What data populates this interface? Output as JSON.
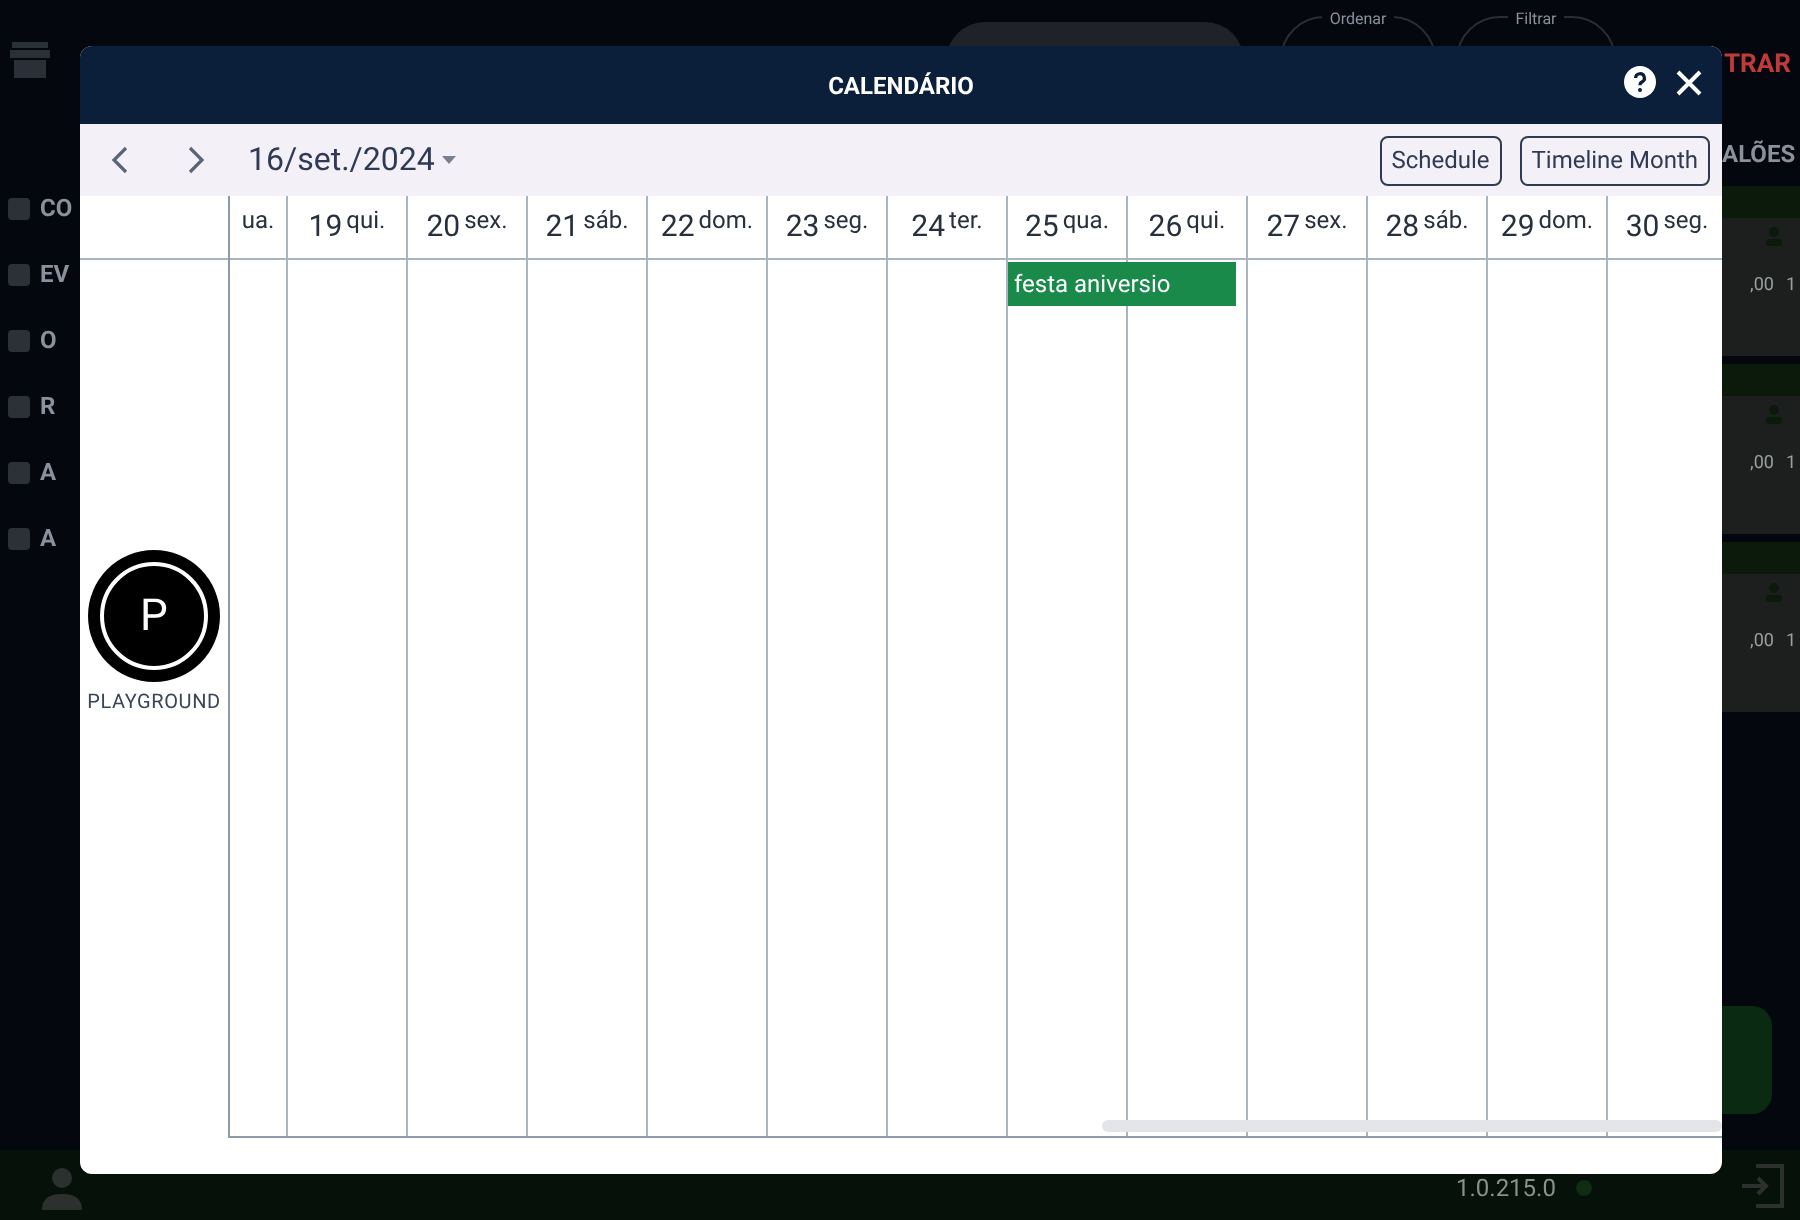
{
  "background_app": {
    "sidebar": [
      {
        "label": "CO"
      },
      {
        "label": "EV"
      },
      {
        "label": "O"
      },
      {
        "label": "R"
      },
      {
        "label": "A"
      },
      {
        "label": "A"
      }
    ],
    "sort_label": "Ordenar",
    "filter_label": "Filtrar",
    "action_text": "TRAR",
    "section_text": "ALÕES",
    "cards": [
      {
        "amount": ",00",
        "count": "1"
      },
      {
        "amount": ",00",
        "count": "1"
      },
      {
        "amount": ",00",
        "count": "1"
      }
    ],
    "version": "1.0.215.0"
  },
  "dialog": {
    "title": "CALENDÁRIO",
    "date": "16/set./2024",
    "views": [
      {
        "label": "Schedule"
      },
      {
        "label": "Timeline Month"
      }
    ],
    "days": [
      {
        "weekday": "ua."
      },
      {
        "day": "19",
        "weekday": "qui."
      },
      {
        "day": "20",
        "weekday": "sex."
      },
      {
        "day": "21",
        "weekday": "sáb."
      },
      {
        "day": "22",
        "weekday": "dom."
      },
      {
        "day": "23",
        "weekday": "seg."
      },
      {
        "day": "24",
        "weekday": "ter."
      },
      {
        "day": "25",
        "weekday": "qua.",
        "events": [
          {
            "title": "festa aniversio",
            "color": "#1a8a4a"
          }
        ]
      },
      {
        "day": "26",
        "weekday": "qui."
      },
      {
        "day": "27",
        "weekday": "sex."
      },
      {
        "day": "28",
        "weekday": "sáb."
      },
      {
        "day": "29",
        "weekday": "dom."
      },
      {
        "day": "30",
        "weekday": "seg."
      }
    ],
    "resources": [
      {
        "initial": "P",
        "name": "PLAYGROUND"
      }
    ]
  }
}
